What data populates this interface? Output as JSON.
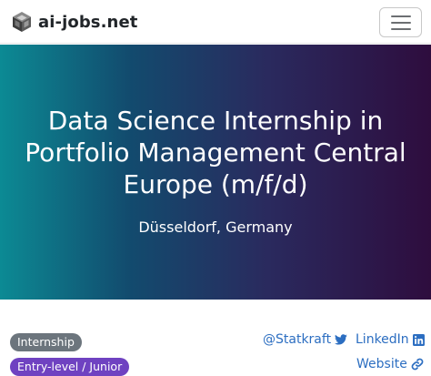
{
  "navbar": {
    "brand": "ai-jobs.net",
    "brand_logo_icon": "cube-logo-icon",
    "menu_icon": "hamburger-menu-icon"
  },
  "hero": {
    "title": "Data Science Internship in Portfolio Management Central Europe (m/f/d)",
    "location": "Düsseldorf, Germany"
  },
  "badges": {
    "job_type": "Internship",
    "level": "Entry-level / Junior"
  },
  "links": {
    "twitter": "@Statkraft",
    "twitter_icon": "twitter-icon",
    "linkedin": "LinkedIn",
    "linkedin_icon": "linkedin-icon",
    "website": "Website",
    "website_icon": "link-icon"
  },
  "colors": {
    "link": "#2c6ec1",
    "badge_internship": "#6c757d",
    "badge_level": "#6f42c1",
    "hero_gradient_start": "#0c8a94",
    "hero_gradient_end": "#2e0d3e"
  }
}
